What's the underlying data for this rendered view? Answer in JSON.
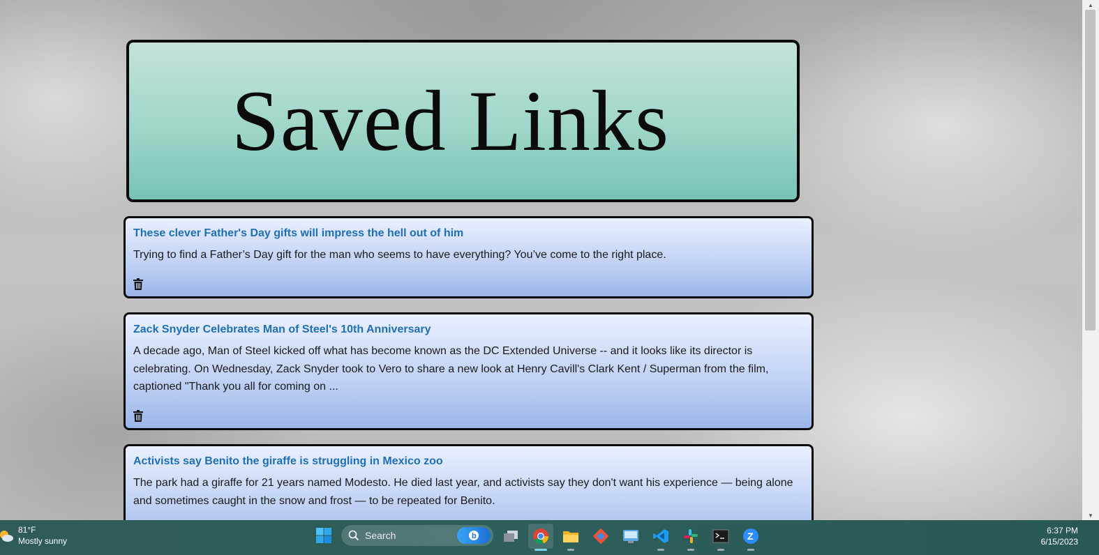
{
  "header": {
    "title": "Saved Links"
  },
  "links": [
    {
      "title": "These clever Father's Day gifts will impress the hell out of him",
      "description": "Trying to find a Father’s Day gift for the man who seems to have everything? You’ve come to the right place."
    },
    {
      "title": "Zack Snyder Celebrates Man of Steel's 10th Anniversary",
      "description": "A decade ago, Man of Steel kicked off what has become known as the DC Extended Universe -- and it looks like its director is celebrating. On Wednesday, Zack Snyder took to Vero to share a new look at Henry Cavill's Clark Kent / Superman from the film, captioned \"Thank you all for coming on ..."
    },
    {
      "title": "Activists say Benito the giraffe is struggling in Mexico zoo",
      "description": "The park had a giraffe for 21 years named Modesto. He died last year, and activists say they don't want his experience — being alone and sometimes caught in the snow and frost — to be repeated for Benito."
    }
  ],
  "taskbar": {
    "weather": {
      "temp": "81°F",
      "condition": "Mostly sunny",
      "icon": "partly-sunny-icon"
    },
    "search_label": "Search",
    "apps": [
      "task-view-icon",
      "chrome-icon",
      "file-explorer-icon",
      "git-icon",
      "control-panel-icon",
      "vscode-icon",
      "slack-icon",
      "terminal-icon",
      "zoom-icon"
    ],
    "time": "6:37 PM",
    "date": "6/15/2023"
  },
  "colors": {
    "header_bg": "#9fd6c9",
    "card_bg": "#c2d3f5",
    "link": "#1e6fb5",
    "taskbar": "#2f5c56"
  }
}
